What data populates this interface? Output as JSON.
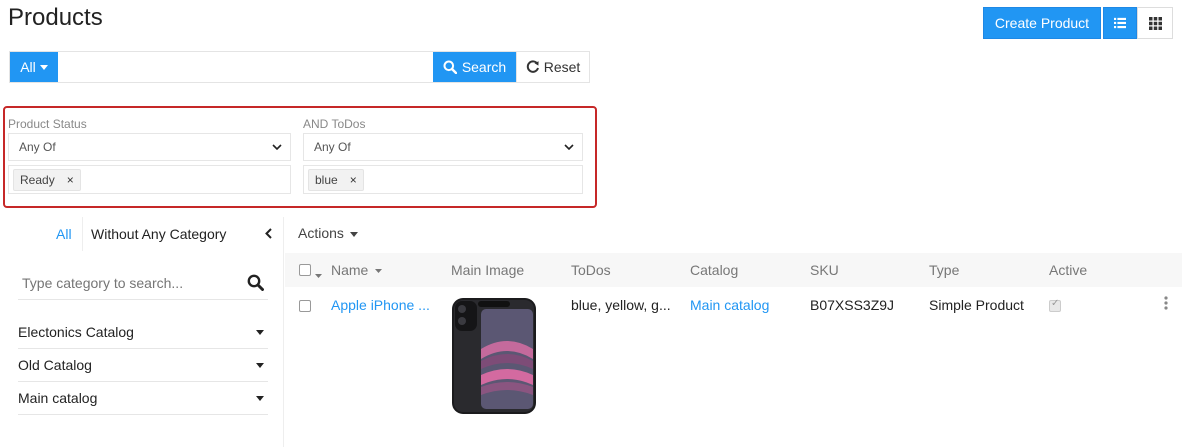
{
  "header": {
    "title": "Products",
    "create_label": "Create Product"
  },
  "search": {
    "scope_label": "All",
    "placeholder": "",
    "search_label": "Search",
    "reset_label": "Reset"
  },
  "filters": {
    "product_status": {
      "label": "Product Status",
      "operator": "Any Of",
      "tags": [
        "Ready"
      ]
    },
    "todos": {
      "label": "AND ToDos",
      "operator": "Any Of",
      "tags": [
        "blue"
      ]
    }
  },
  "sidebar": {
    "tab_all": "All",
    "tab_without": "Without Any Category",
    "search_placeholder": "Type category to search...",
    "catalogs": [
      {
        "label": "Electonics Catalog"
      },
      {
        "label": "Old Catalog"
      },
      {
        "label": "Main catalog"
      }
    ]
  },
  "table": {
    "actions_label": "Actions",
    "columns": {
      "name": "Name",
      "main_image": "Main Image",
      "todos": "ToDos",
      "catalog": "Catalog",
      "sku": "SKU",
      "type": "Type",
      "active": "Active"
    },
    "rows": [
      {
        "name": "Apple iPhone ...",
        "todos": "blue, yellow, g...",
        "catalog": "Main catalog",
        "sku": "B07XSS3Z9J",
        "type": "Simple Product",
        "active": true
      }
    ]
  },
  "colors": {
    "primary": "#2196f3",
    "highlight_border": "#c62828"
  }
}
